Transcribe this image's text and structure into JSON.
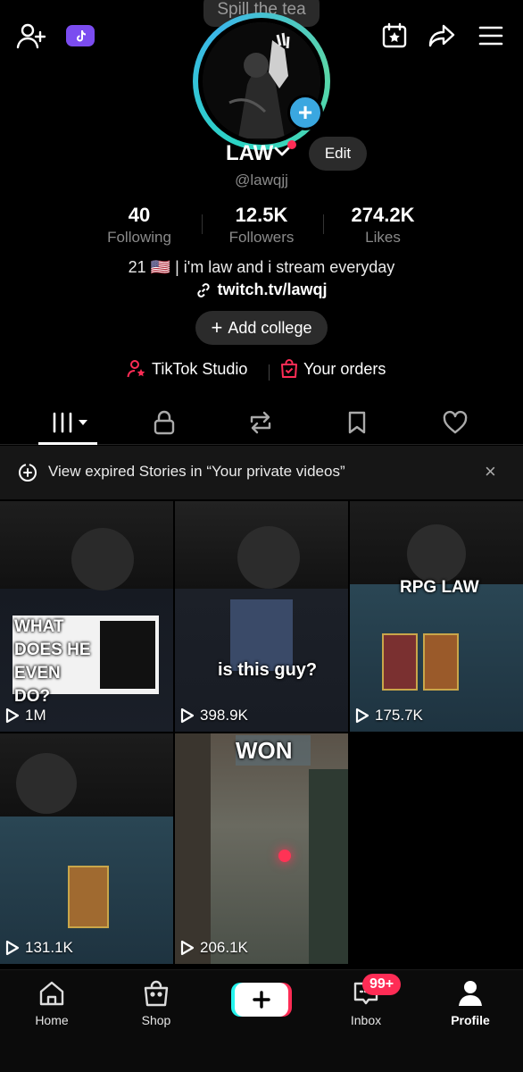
{
  "tooltip": "Spill the tea",
  "profile": {
    "name": "LAW",
    "handle": "@lawqjj",
    "edit_label": "Edit",
    "bio": "21 🇺🇸 | i'm law and i stream everyday",
    "link": "twitch.tv/lawqj",
    "add_college_label": "Add college"
  },
  "stats": [
    {
      "value": "40",
      "label": "Following"
    },
    {
      "value": "12.5K",
      "label": "Followers"
    },
    {
      "value": "274.2K",
      "label": "Likes"
    }
  ],
  "tools": {
    "studio_label": "TikTok Studio",
    "orders_label": "Your orders"
  },
  "banner": {
    "text": "View expired Stories in “Your private videos”",
    "close": "×"
  },
  "videos": [
    {
      "views": "1M",
      "overlay": "WHAT DOES HE EVEN DO?"
    },
    {
      "views": "398.9K",
      "overlay": "is this guy?"
    },
    {
      "views": "175.7K",
      "overlay": "RPG LAW"
    },
    {
      "views": "131.1K",
      "overlay": ""
    },
    {
      "views": "206.1K",
      "overlay": "WON"
    }
  ],
  "nav": {
    "home": "Home",
    "shop": "Shop",
    "inbox": "Inbox",
    "inbox_badge": "99+",
    "profile": "Profile"
  },
  "colors": {
    "accent_red": "#fe2c55",
    "accent_cyan": "#25f4ee",
    "avatar_ring": "#2bd4c4",
    "add_badge": "#3aa7e0"
  }
}
